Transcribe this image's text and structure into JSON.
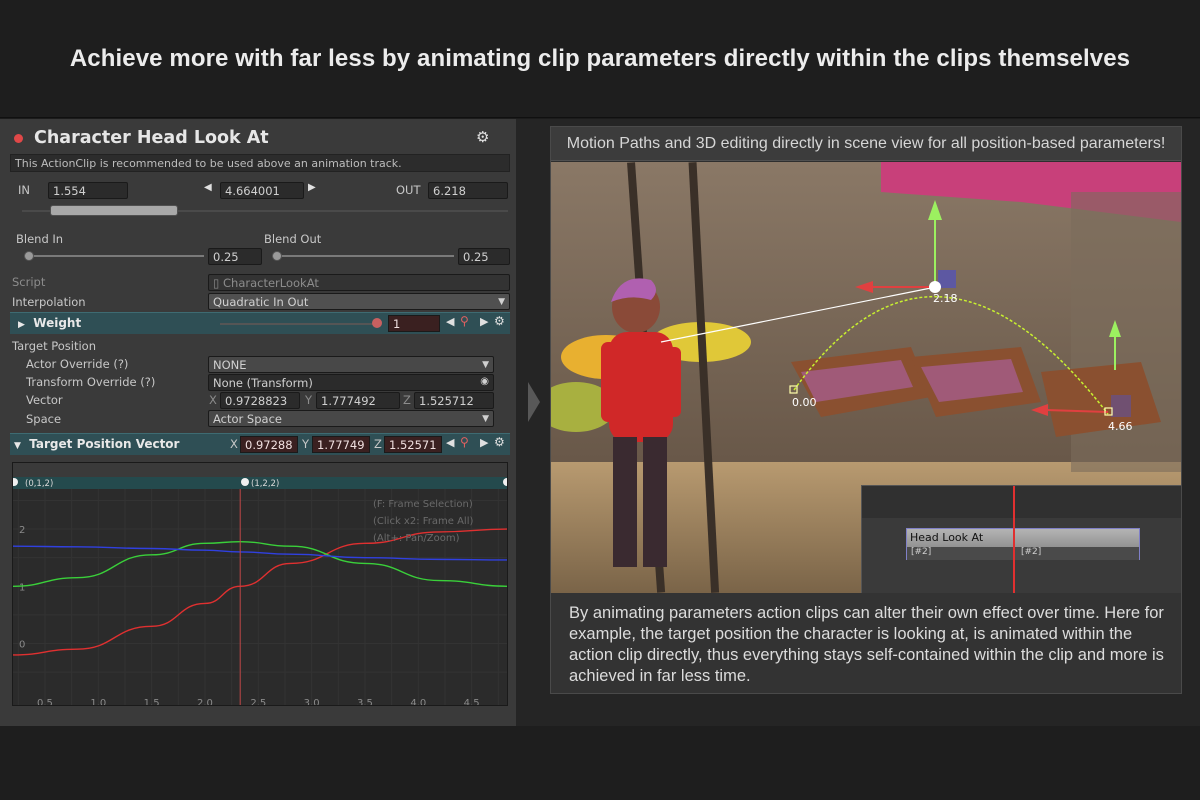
{
  "headline": "Achieve more with far less by animating clip parameters directly within the clips themselves",
  "inspector": {
    "title": "Character Head Look At",
    "gear_icon": "gear-icon",
    "note": "This ActionClip is recommended to be used above an animation track.",
    "in_label": "IN",
    "in_value": "1.554",
    "length_value": "4.664001",
    "out_label": "OUT",
    "out_value": "6.218",
    "blend_in_label": "Blend In",
    "blend_in_value": "0.25",
    "blend_out_label": "Blend Out",
    "blend_out_value": "0.25",
    "script_label": "Script",
    "script_value": "CharacterLookAt",
    "interpolation_label": "Interpolation",
    "interpolation_value": "Quadratic In Out",
    "weight_label": "Weight",
    "weight_value": "1",
    "target_position_label": "Target Position",
    "actor_override_label": "Actor Override (?)",
    "actor_override_value": "NONE",
    "transform_override_label": "Transform Override (?)",
    "transform_override_value": "None (Transform)",
    "vector_label": "Vector",
    "vector_x": "0.9728823",
    "vector_y": "1.777492",
    "vector_z": "1.525712",
    "space_label": "Space",
    "space_value": "Actor Space",
    "tpv_label": "Target Position Vector",
    "tpv_x": "0.97288",
    "tpv_y": "1.77749",
    "tpv_z": "1.52571",
    "axis_x": "X",
    "axis_y": "Y",
    "axis_z": "Z"
  },
  "graph": {
    "key_left": "(0,1,2)",
    "key_mid": "(1,2,2)",
    "hint1": "(F: Frame Selection)",
    "hint2": "(Click x2: Frame All)",
    "hint3": "(Alt+: Pan/Zoom)",
    "y_ticks": [
      "2",
      "1",
      "0"
    ],
    "x_ticks": [
      "0.5",
      "1.0",
      "1.5",
      "2.0",
      "2.5",
      "3.0",
      "3.5",
      "4.0",
      "4.5"
    ],
    "colors": {
      "x": "#e03030",
      "y": "#3ad03a",
      "z": "#3040e0"
    }
  },
  "chart_data": {
    "type": "line",
    "title": "",
    "xlabel": "",
    "ylabel": "",
    "xlim": [
      0.2,
      4.85
    ],
    "ylim": [
      -0.9,
      2.7
    ],
    "series": [
      {
        "x": [
          0.2,
          0.8,
          1.5,
          2.0,
          2.33,
          2.8,
          3.5,
          4.2,
          4.85
        ],
        "values": [
          -0.2,
          -0.1,
          0.3,
          0.7,
          1.0,
          1.4,
          1.75,
          1.95,
          2.0
        ]
      },
      {
        "x": [
          0.2,
          0.8,
          1.5,
          2.0,
          2.33,
          2.8,
          3.5,
          4.2,
          4.85
        ],
        "values": [
          1.0,
          1.15,
          1.55,
          1.75,
          1.78,
          1.7,
          1.4,
          1.1,
          1.0
        ]
      },
      {
        "x": [
          0.2,
          0.8,
          1.5,
          2.0,
          2.33,
          2.8,
          3.5,
          4.2,
          4.85
        ],
        "values": [
          1.7,
          1.69,
          1.66,
          1.63,
          1.6,
          1.56,
          1.5,
          1.47,
          1.46
        ]
      }
    ]
  },
  "scene": {
    "label_start": "0.00",
    "label_mid": "2.18",
    "label_end": "4.66",
    "clip_label": "Head Look At",
    "clip_tag_left": "[#2]",
    "clip_tag_right": "[#2]"
  },
  "right_panel": {
    "title": "Motion Paths and 3D editing directly in scene view for all position-based parameters!",
    "description": "By animating parameters action clips can alter their own effect over time. Here for example, the target position the character is looking at, is animated within the action clip directly, thus everything stays self-contained within the clip and more is achieved in far less time."
  }
}
